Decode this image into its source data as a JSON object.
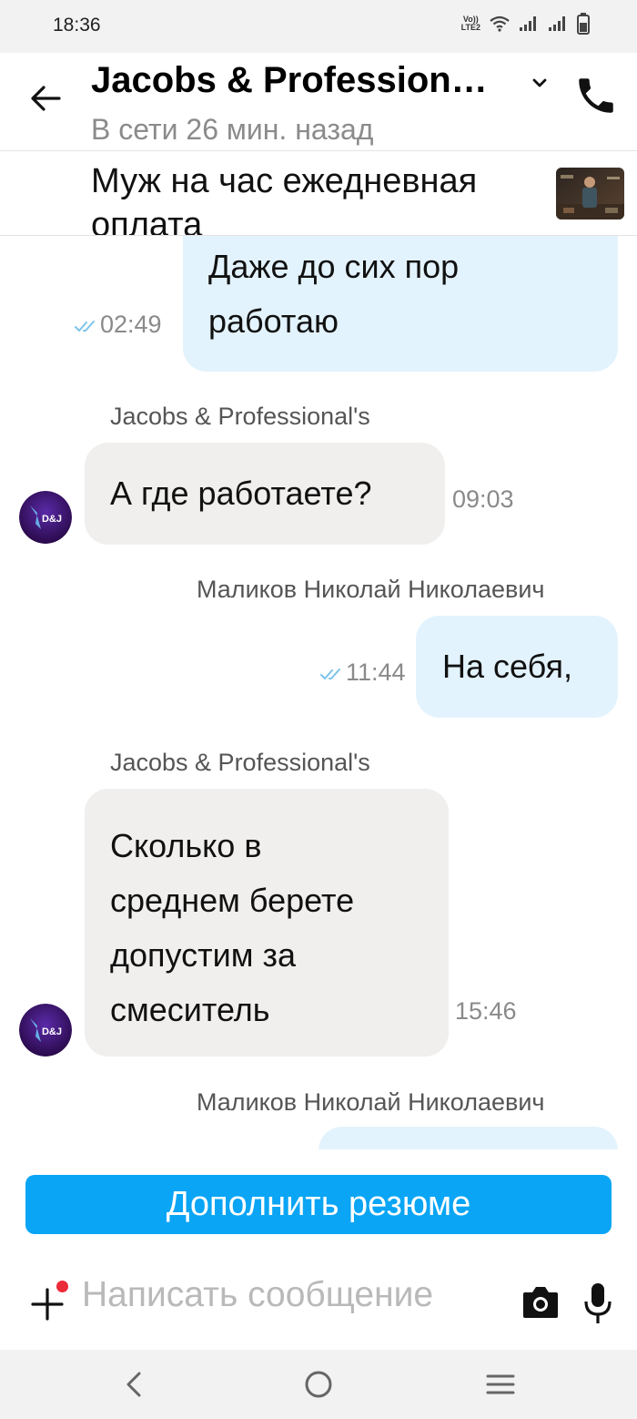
{
  "status_bar": {
    "time": "18:36",
    "volte_line1": "Vo))",
    "volte_line2": "LTE2"
  },
  "header": {
    "title": "Jacobs & Profession…",
    "subtitle": "В сети 26 мин. назад"
  },
  "vacancy": {
    "title": "Муж на час ежедневная оплата"
  },
  "messages": [
    {
      "direction": "out",
      "text_lines": [
        "Даже до сих пор",
        "работаю"
      ],
      "time": "02:49"
    },
    {
      "direction": "in",
      "sender": "Jacobs & Professional's",
      "avatar_text": "D&J",
      "text": "А где работаете?",
      "time": "09:03"
    },
    {
      "direction": "out",
      "sender": "Маликов Николай Николаевич",
      "text": "На себя,",
      "time": "11:44"
    },
    {
      "direction": "in",
      "sender": "Jacobs & Professional's",
      "avatar_text": "D&J",
      "text_lines": [
        "Сколько в",
        "среднем берете",
        "допустим за",
        "смеситель"
      ],
      "time": "15:46"
    },
    {
      "direction": "out",
      "sender": "Маликов Николай Николаевич"
    }
  ],
  "composer": {
    "resume_button_label": "Дополнить резюме",
    "input_placeholder": "Написать сообщение"
  },
  "colors": {
    "accent": "#0aa5f5",
    "outgoing_bubble": "#e3f3fd",
    "incoming_bubble": "#f0efee",
    "notification_dot": "#ec2b38"
  }
}
